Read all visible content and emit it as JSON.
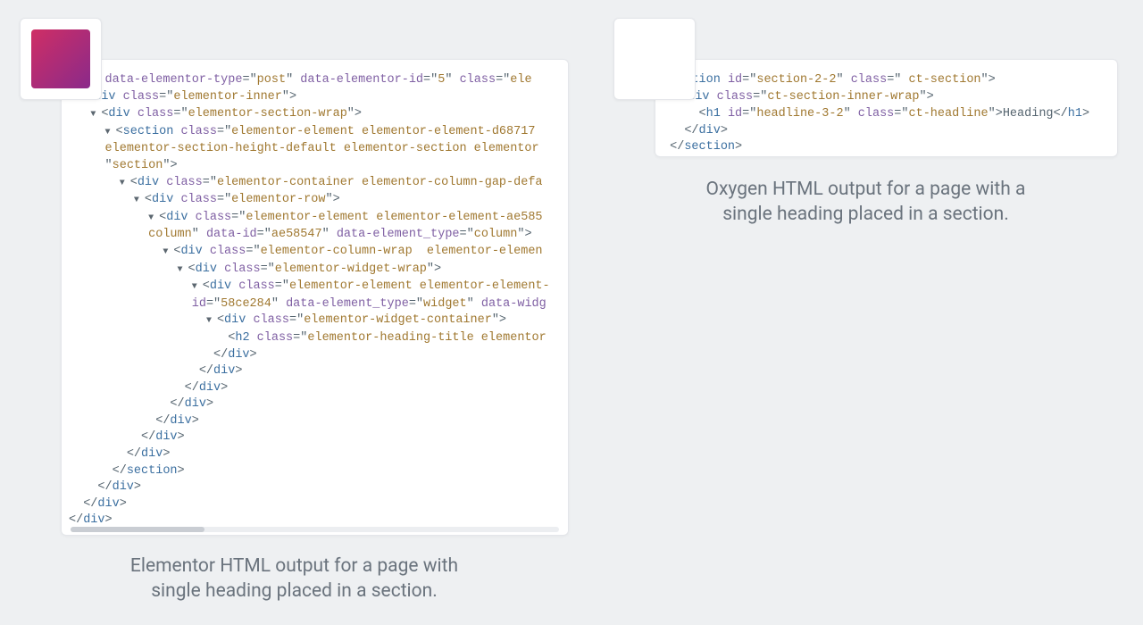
{
  "left": {
    "caption_l1": "Elementor HTML output for a page with",
    "caption_l2": "single heading placed in a section.",
    "code": {
      "type_attr": "post",
      "type_id": "5",
      "classes": {
        "inner": "elementor-inner",
        "section_wrap": "elementor-section-wrap",
        "section": "elementor-element elementor-element-d68717",
        "section2": "elementor-section-height-default elementor-section elementor",
        "section_tag": "section",
        "container": "elementor-container elementor-column-gap-defa",
        "row": "elementor-row",
        "col1": "elementor-element elementor-element-ae585",
        "col_word": "column",
        "col_id": "ae58547",
        "col_type": "column",
        "col_wrap": "elementor-column-wrap  elementor-elemen",
        "widget_wrap": "elementor-widget-wrap",
        "widget1": "elementor-element elementor-element-",
        "widget_id": "58ce284",
        "widget_type": "widget",
        "widget_container": "elementor-widget-container",
        "h2": "elementor-heading-title elementor"
      }
    }
  },
  "right": {
    "caption_l1": "Oxygen HTML output for a page with a",
    "caption_l2": "single heading placed in a section.",
    "code": {
      "section_id": "section-2-2",
      "section_class": " ct-section",
      "inner_class": "ct-section-inner-wrap",
      "h1_id": "headline-3-2",
      "h1_class": "ct-headline",
      "h1_text": "Heading"
    }
  }
}
